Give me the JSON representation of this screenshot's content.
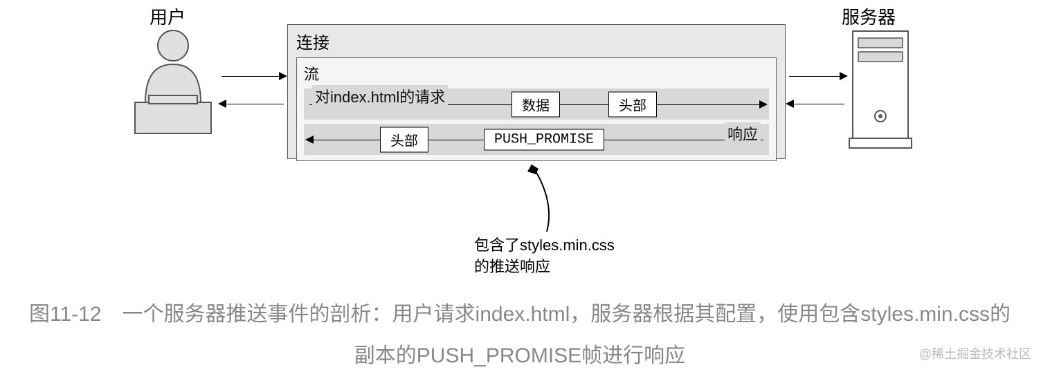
{
  "labels": {
    "user": "用户",
    "server": "服务器",
    "connection": "连接",
    "stream": "流"
  },
  "request_row": {
    "label": "对index.html的请求",
    "node1": "数据",
    "node2": "头部"
  },
  "response_row": {
    "label": "响应",
    "node1": "头部",
    "node2": "PUSH_PROMISE"
  },
  "annotation": {
    "line1": "包含了styles.min.css",
    "line2": "的推送响应"
  },
  "caption": "图11-12　一个服务器推送事件的剖析：用户请求index.html，服务器根据其配置，使用包含styles.min.css的副本的PUSH_PROMISE帧进行响应",
  "watermark": "@稀土掘金技术社区"
}
